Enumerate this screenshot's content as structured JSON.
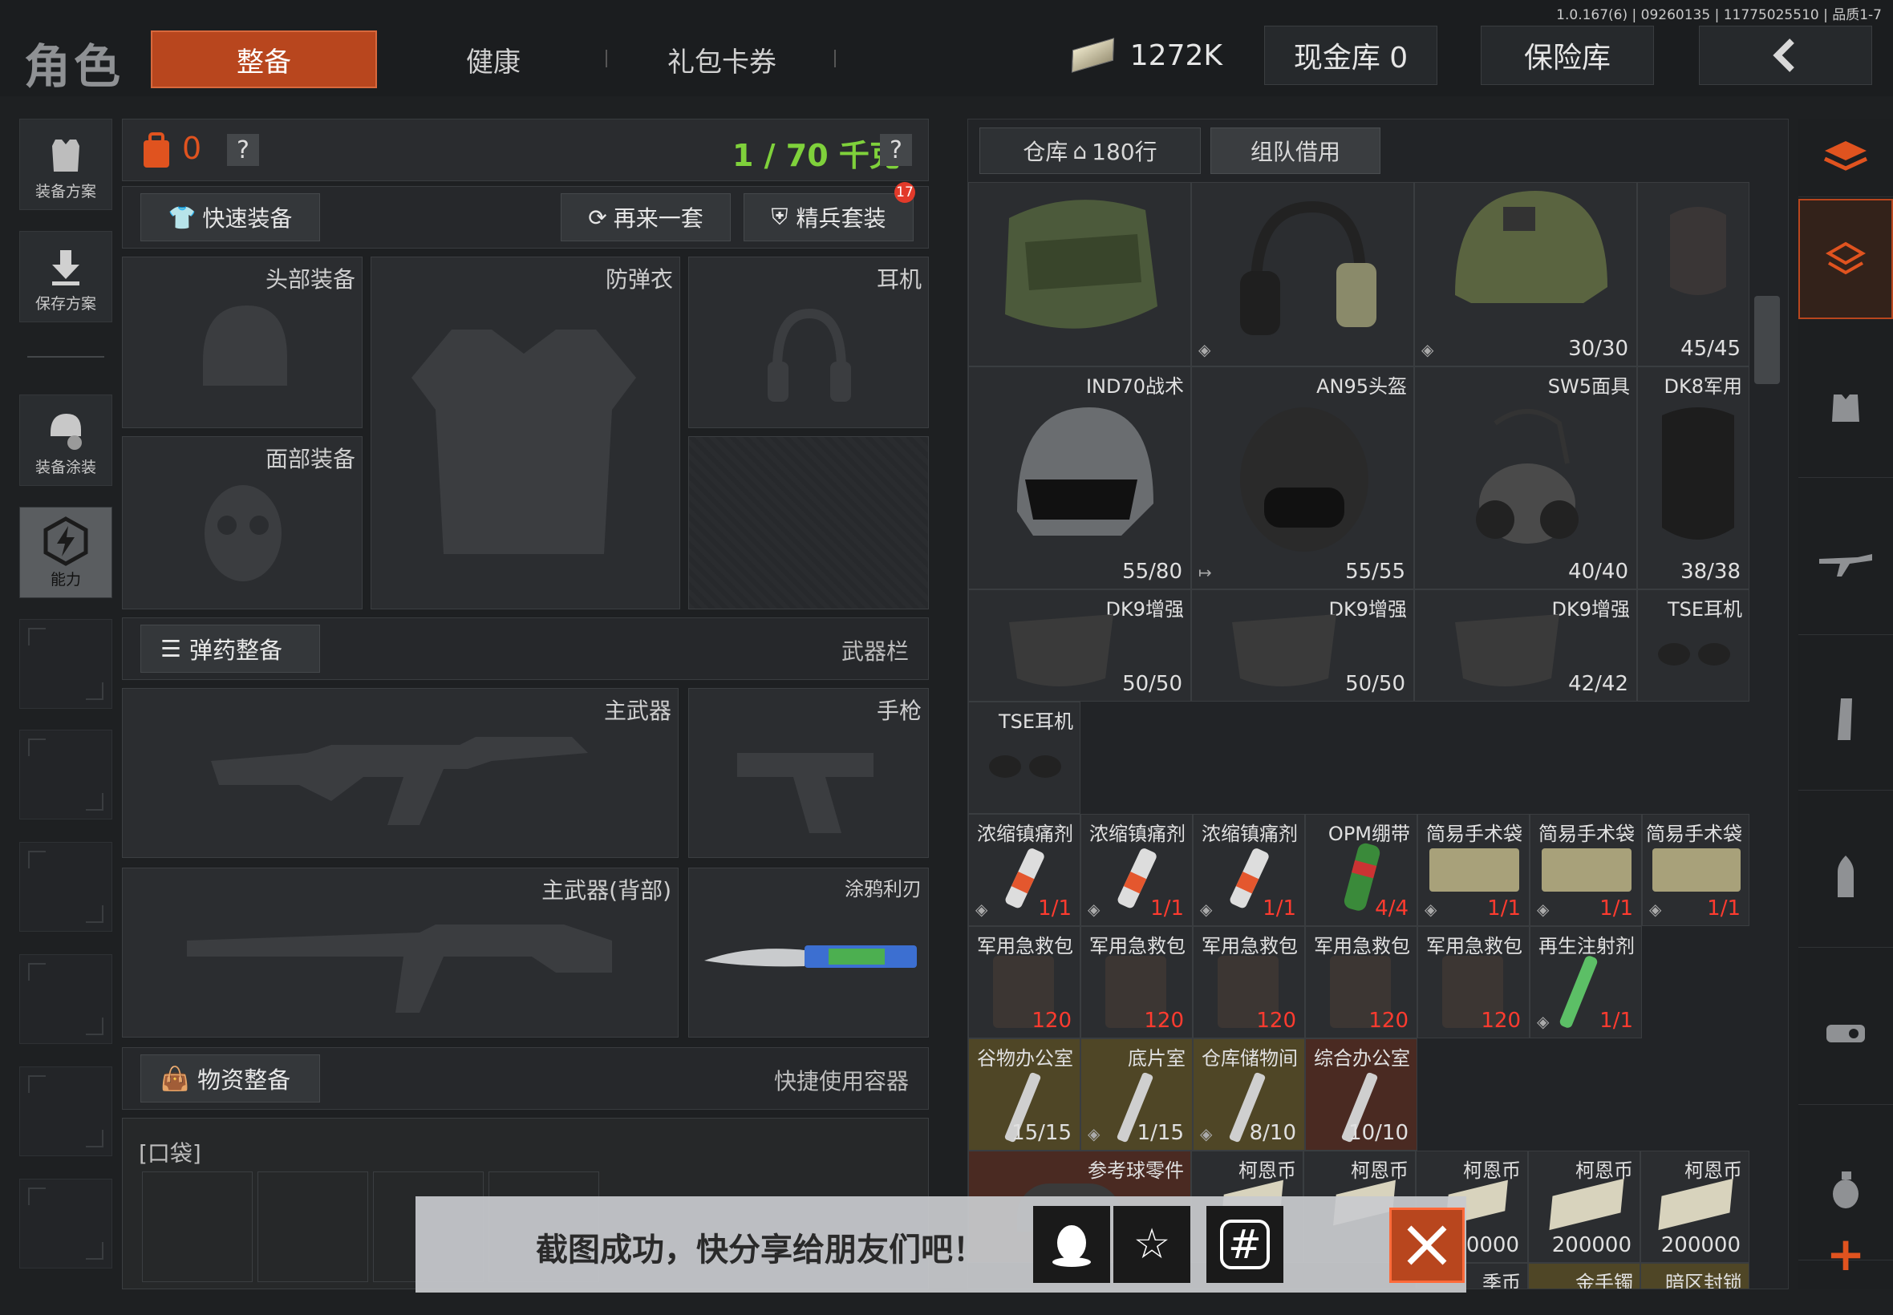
{
  "version": "1.0.167(6) | 09260135 | 11775025510 | 品质1-7",
  "header": {
    "title": "角色",
    "tabs": [
      {
        "label": "整备",
        "active": true
      },
      {
        "label": "健康",
        "active": false
      },
      {
        "label": "礼包卡券",
        "active": false
      }
    ],
    "currency": "1272K",
    "cash_vault": "现金库 0",
    "safe": "保险库"
  },
  "left_sidebar": [
    {
      "label": "装备方案",
      "icon": "vest-icon"
    },
    {
      "label": "保存方案",
      "icon": "download-arrow-icon"
    },
    {
      "label": "装备涂装",
      "icon": "helmet-paint-icon"
    },
    {
      "label": "能力",
      "icon": "ability-icon",
      "active": true
    }
  ],
  "equip": {
    "count": "0",
    "weight": "1 / 70 千克",
    "quick_equip": "快速装备",
    "another_set": "再来一套",
    "elite_set": "精兵套装",
    "elite_badge": "17",
    "slots": {
      "head": "头部装备",
      "armor": "防弹衣",
      "headset": "耳机",
      "face": "面部装备"
    },
    "ammo_title": "弹药整备",
    "weapon_bar": "武器栏",
    "primary": "主武器",
    "pistol": "手枪",
    "primary_back": "主武器(背部)",
    "knife": "涂鸦利刃",
    "supply_title": "物资整备",
    "quick_container": "快捷使用容器",
    "pocket": "[口袋]"
  },
  "warehouse": {
    "tab": "仓库",
    "rows": "180行",
    "team_borrow": "组队借用"
  },
  "items": {
    "r1": [
      "",
      "",
      "30/30",
      "45/45"
    ],
    "r2": [
      {
        "name": "IND70战术",
        "count": "55/80"
      },
      {
        "name": "AN95头盔",
        "count": "55/55"
      },
      {
        "name": "SW5面具",
        "count": "40/40"
      },
      {
        "name": "DK8军用",
        "count": "38/38"
      }
    ],
    "r3": [
      {
        "name": "DK9增强",
        "count": "50/50"
      },
      {
        "name": "DK9增强",
        "count": "50/50"
      },
      {
        "name": "DK9增强",
        "count": "42/42"
      },
      {
        "name": "TSE耳机",
        "count": ""
      }
    ],
    "r4": [
      {
        "name": "TSE耳机",
        "count": ""
      }
    ],
    "meds": [
      {
        "name": "浓缩镇痛剂",
        "count": "1/1"
      },
      {
        "name": "浓缩镇痛剂",
        "count": "1/1"
      },
      {
        "name": "浓缩镇痛剂",
        "count": "1/1"
      },
      {
        "name": "OPM绷带",
        "count": "4/4"
      },
      {
        "name": "简易手术袋",
        "count": "1/1"
      },
      {
        "name": "简易手术袋",
        "count": "1/1"
      },
      {
        "name": "简易手术袋",
        "count": "1/1"
      }
    ],
    "kits": [
      {
        "name": "军用急救包",
        "count": "120"
      },
      {
        "name": "军用急救包",
        "count": "120"
      },
      {
        "name": "军用急救包",
        "count": "120"
      },
      {
        "name": "军用急救包",
        "count": "120"
      },
      {
        "name": "军用急救包",
        "count": "120"
      },
      {
        "name": "再生注射剂",
        "count": "1/1"
      }
    ],
    "keys": [
      {
        "name": "谷物办公室",
        "count": "15/15"
      },
      {
        "name": "底片室",
        "count": "1/15"
      },
      {
        "name": "仓库储物间",
        "count": "8/10"
      },
      {
        "name": "综合办公室",
        "count": "10/10"
      }
    ],
    "coins": [
      {
        "name": "参考球零件",
        "count": ""
      },
      {
        "name": "柯恩币",
        "count": ""
      },
      {
        "name": "柯恩币",
        "count": ""
      },
      {
        "name": "柯恩币",
        "count": "0000"
      },
      {
        "name": "柯恩币",
        "count": "200000"
      },
      {
        "name": "柯恩币",
        "count": "200000"
      }
    ],
    "bottom": [
      "季币",
      "金手镯",
      "暗区封锁"
    ]
  },
  "toast": {
    "text": "截图成功，快分享给朋友们吧！"
  },
  "colors": {
    "accent": "#b8461e",
    "weight_green": "#7fd13b",
    "count_red": "#ff3b2f"
  }
}
